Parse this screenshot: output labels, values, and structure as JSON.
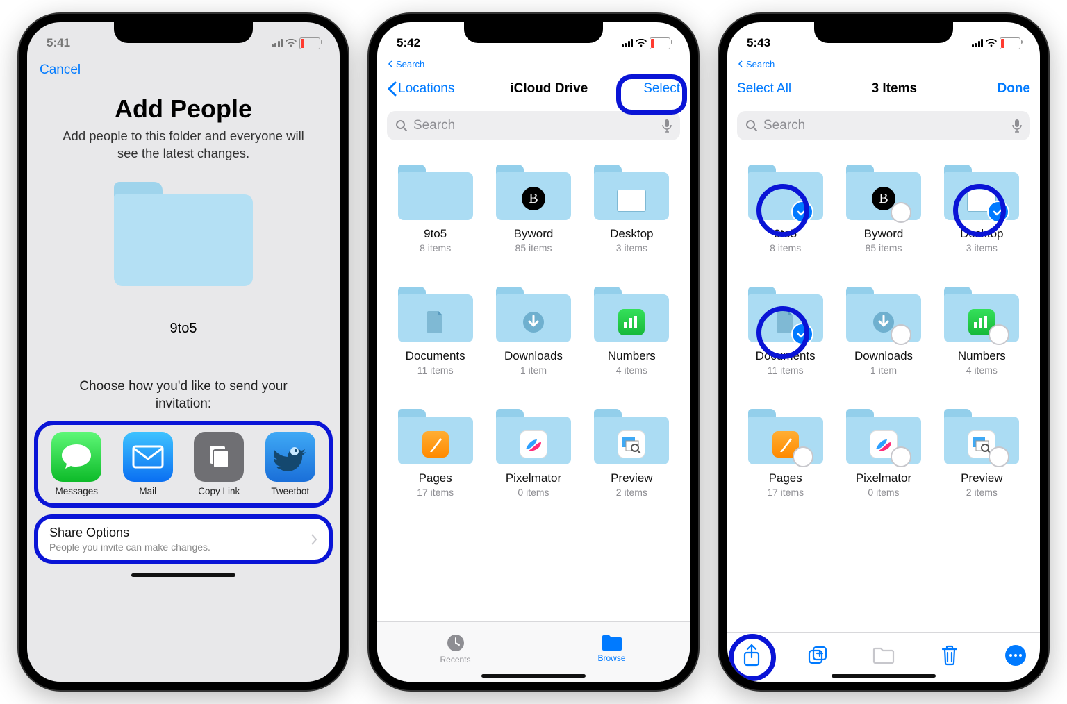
{
  "screen1": {
    "status_time": "5:41",
    "nav_cancel": "Cancel",
    "title": "Add People",
    "subtitle": "Add people to this folder and everyone will see the latest changes.",
    "folder_name": "9to5",
    "choose_prompt": "Choose how you'd like to send your invitation:",
    "share": [
      {
        "label": "Messages"
      },
      {
        "label": "Mail"
      },
      {
        "label": "Copy Link"
      },
      {
        "label": "Tweetbot"
      }
    ],
    "options_title": "Share Options",
    "options_subtitle": "People you invite can make changes."
  },
  "screen2": {
    "status_time": "5:42",
    "breadcrumb": "Search",
    "nav_back": "Locations",
    "nav_title": "iCloud Drive",
    "nav_select": "Select",
    "search_placeholder": "Search",
    "folders": [
      {
        "name": "9to5",
        "meta": "8 items",
        "badge": null
      },
      {
        "name": "Byword",
        "meta": "85 items",
        "badge": "B-black"
      },
      {
        "name": "Desktop",
        "meta": "3 items",
        "badge": "desktop"
      },
      {
        "name": "Documents",
        "meta": "11 items",
        "badge": "doc"
      },
      {
        "name": "Downloads",
        "meta": "1 item",
        "badge": "down"
      },
      {
        "name": "Numbers",
        "meta": "4 items",
        "badge": "numbers"
      },
      {
        "name": "Pages",
        "meta": "17 items",
        "badge": "pages"
      },
      {
        "name": "Pixelmator",
        "meta": "0 items",
        "badge": "pixel"
      },
      {
        "name": "Preview",
        "meta": "2 items",
        "badge": "preview"
      }
    ],
    "tab_recents": "Recents",
    "tab_browse": "Browse"
  },
  "screen3": {
    "status_time": "5:43",
    "breadcrumb": "Search",
    "nav_selectall": "Select All",
    "nav_title": "3 Items",
    "nav_done": "Done",
    "search_placeholder": "Search",
    "folders": [
      {
        "name": "9to5",
        "meta": "8 items",
        "selected": true,
        "badge": null
      },
      {
        "name": "Byword",
        "meta": "85 items",
        "selected": false,
        "badge": "B-black"
      },
      {
        "name": "Desktop",
        "meta": "3 items",
        "selected": true,
        "badge": "desktop"
      },
      {
        "name": "Documents",
        "meta": "11 items",
        "selected": true,
        "badge": "doc"
      },
      {
        "name": "Downloads",
        "meta": "1 item",
        "selected": false,
        "badge": "down"
      },
      {
        "name": "Numbers",
        "meta": "4 items",
        "selected": false,
        "badge": "numbers"
      },
      {
        "name": "Pages",
        "meta": "17 items",
        "selected": false,
        "badge": "pages"
      },
      {
        "name": "Pixelmator",
        "meta": "0 items",
        "selected": false,
        "badge": "pixel"
      },
      {
        "name": "Preview",
        "meta": "2 items",
        "selected": false,
        "badge": "preview"
      }
    ]
  }
}
